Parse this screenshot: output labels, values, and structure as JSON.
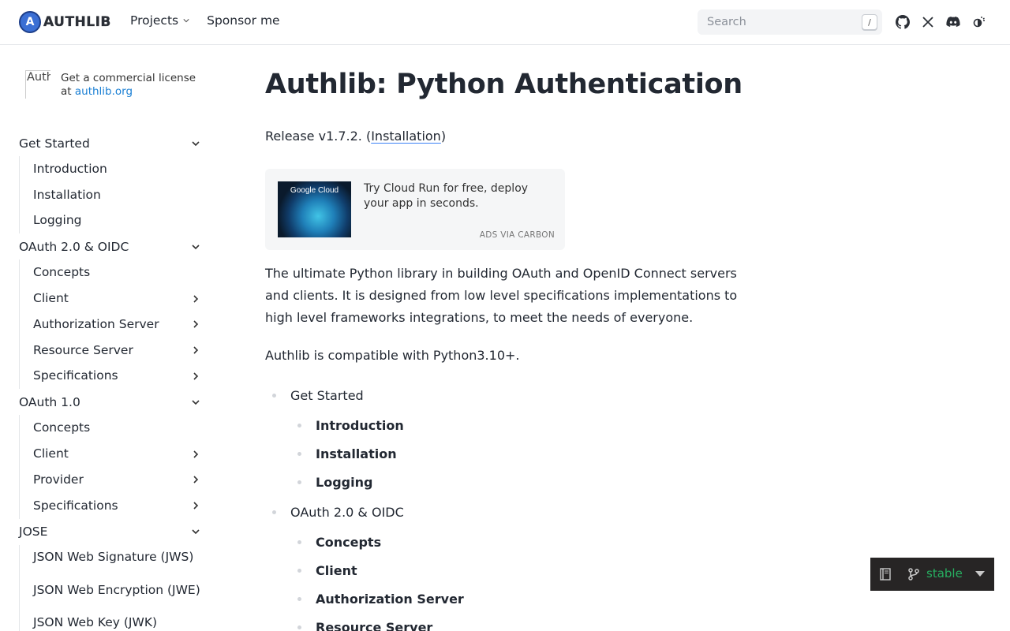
{
  "header": {
    "logo_text": "AUTHLIB",
    "logo_letter": "A",
    "nav": [
      {
        "label": "Projects",
        "has_dropdown": true
      },
      {
        "label": "Sponsor me",
        "has_dropdown": false
      }
    ],
    "search_placeholder": "Search",
    "search_shortcut": "/",
    "icons": [
      "github-icon",
      "x-icon",
      "discord-icon",
      "theme-toggle-icon"
    ]
  },
  "sidebar": {
    "ad_image_alt": "Auth",
    "ad_text": "Get a commercial license at ",
    "ad_link": "authlib.org",
    "sections": [
      {
        "label": "Get Started",
        "items": [
          {
            "label": "Introduction",
            "expandable": false
          },
          {
            "label": "Installation",
            "expandable": false
          },
          {
            "label": "Logging",
            "expandable": false
          }
        ]
      },
      {
        "label": "OAuth 2.0 & OIDC",
        "items": [
          {
            "label": "Concepts",
            "expandable": false
          },
          {
            "label": "Client",
            "expandable": true
          },
          {
            "label": "Authorization Server",
            "expandable": true
          },
          {
            "label": "Resource Server",
            "expandable": true
          },
          {
            "label": "Specifications",
            "expandable": true
          }
        ]
      },
      {
        "label": "OAuth 1.0",
        "items": [
          {
            "label": "Concepts",
            "expandable": false
          },
          {
            "label": "Client",
            "expandable": true
          },
          {
            "label": "Provider",
            "expandable": true
          },
          {
            "label": "Specifications",
            "expandable": true
          }
        ]
      },
      {
        "label": "JOSE",
        "items": [
          {
            "label": "JSON Web Signature (JWS)",
            "expandable": false
          },
          {
            "label": "JSON Web Encryption (JWE)",
            "expandable": false
          },
          {
            "label": "JSON Web Key (JWK)",
            "expandable": false
          }
        ]
      }
    ]
  },
  "main": {
    "title": "Authlib: Python Authentication",
    "release_prefix": "Release v1.7.2. (",
    "release_link": "Installation",
    "release_suffix": ")",
    "carbon": {
      "image_label": "Google Cloud",
      "text": "Try Cloud Run for free, deploy your app in seconds.",
      "via": "ADS VIA CARBON"
    },
    "intro": "The ultimate Python library in building OAuth and OpenID Connect servers and clients. It is designed from low level specifications implementations to high level frameworks integrations, to meet the needs of everyone.",
    "compat": "Authlib is compatible with Python3.10+.",
    "toc": [
      {
        "label": "Get Started",
        "children": [
          "Introduction",
          "Installation",
          "Logging"
        ]
      },
      {
        "label": "OAuth 2.0 & OIDC",
        "children": [
          "Concepts",
          "Client",
          "Authorization Server",
          "Resource Server"
        ]
      }
    ]
  },
  "version_badge": {
    "label": "stable"
  },
  "colors": {
    "link": "#1a7fd4",
    "badge_bg": "#272525",
    "badge_text": "#27ae60"
  }
}
